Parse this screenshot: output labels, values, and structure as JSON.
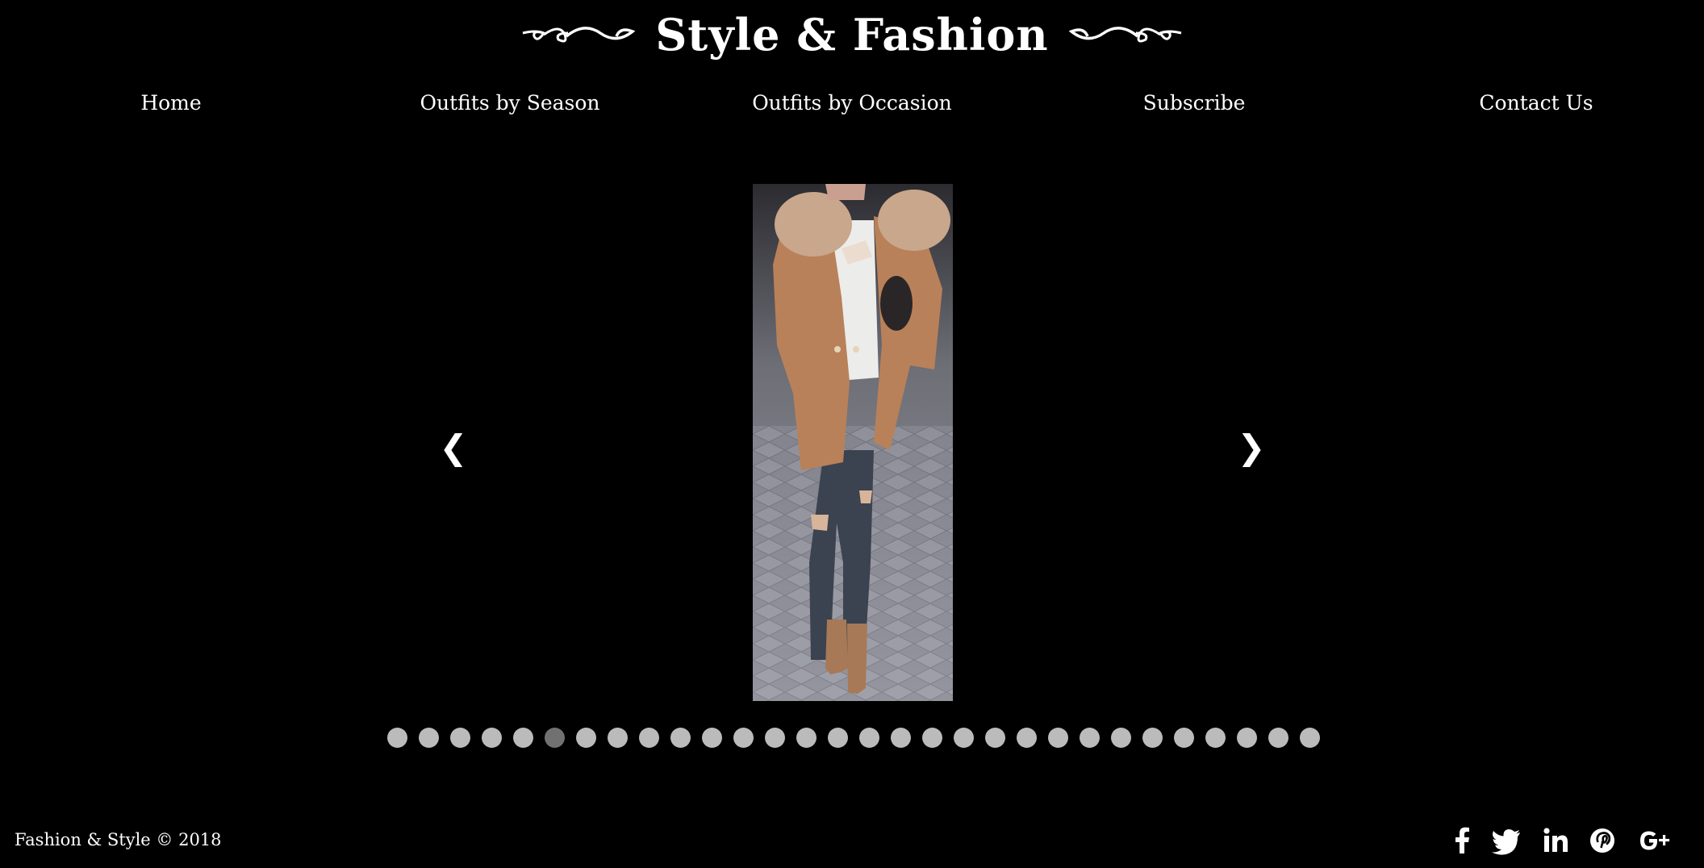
{
  "header": {
    "title": "Style & Fashion"
  },
  "nav": {
    "items": [
      {
        "label": "Home"
      },
      {
        "label": "Outfits by Season"
      },
      {
        "label": "Outfits by Occasion"
      },
      {
        "label": "Subscribe"
      },
      {
        "label": "Contact Us"
      }
    ]
  },
  "slideshow": {
    "prev_label": "❮",
    "next_label": "❯",
    "total_slides": 30,
    "active_slide": 6,
    "dot_color": "#bbbbbb",
    "active_dot_color": "#717171"
  },
  "footer": {
    "copyright": "Fashion & Style © 2018",
    "social_icons": [
      "facebook-icon",
      "twitter-icon",
      "linkedin-icon",
      "pinterest-icon",
      "google-plus-icon"
    ]
  }
}
